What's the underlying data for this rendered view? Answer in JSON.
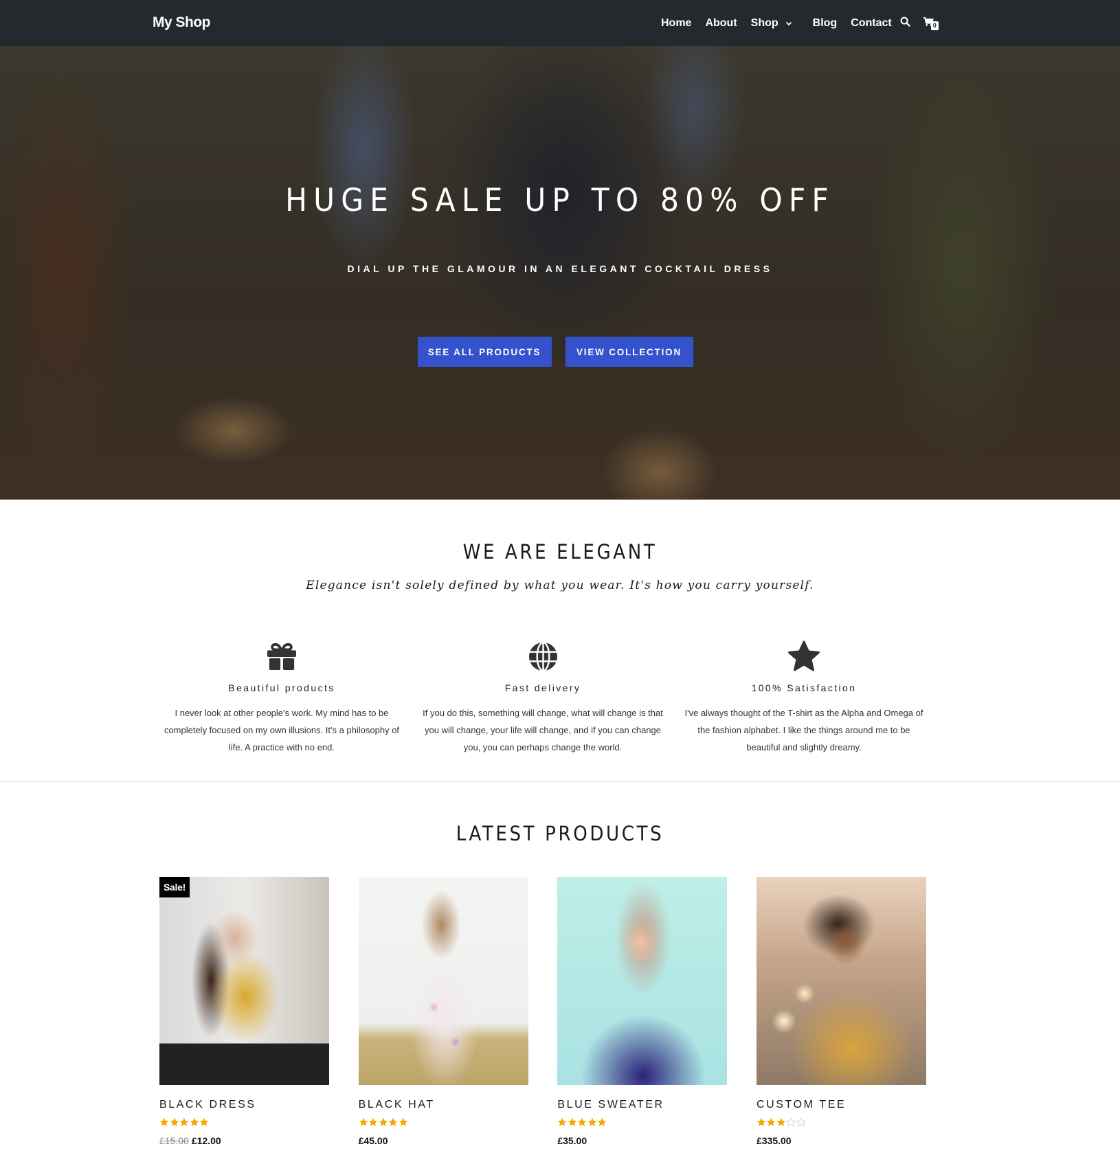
{
  "header": {
    "logo": "My Shop",
    "nav": [
      {
        "label": "Home"
      },
      {
        "label": "About"
      },
      {
        "label": "Shop",
        "has_dropdown": true
      },
      {
        "label": "Blog"
      },
      {
        "label": "Contact"
      }
    ],
    "search_icon": "search-icon",
    "cart_icon": "cart-icon",
    "cart_count": "0"
  },
  "hero": {
    "title": "HUGE SALE UP TO 80% OFF",
    "subtitle": "DIAL UP THE GLAMOUR IN AN ELEGANT COCKTAIL DRESS",
    "buttons": [
      {
        "label": "SEE ALL PRODUCTS"
      },
      {
        "label": "VIEW COLLECTION"
      }
    ]
  },
  "elegant": {
    "title": "WE ARE ELEGANT",
    "subtitle": "Elegance isn't solely defined by what you wear. It's how you carry yourself.",
    "features": [
      {
        "icon": "gift-icon",
        "title": "Beautiful products",
        "text": "I never look at other people's work. My mind has to be completely focused on my own illusions. It's a philosophy of life. A practice with no end."
      },
      {
        "icon": "globe-icon",
        "title": "Fast delivery",
        "text": "If you do this, something will change, what will change is that you will change, your life will change, and if you can change you, you can perhaps change the world."
      },
      {
        "icon": "star-icon",
        "title": "100% Satisfaction",
        "text": "I've always thought of the T-shirt as the Alpha and Omega of the fashion alphabet. I like the things around me to be beautiful and slightly dreamy."
      }
    ]
  },
  "products": {
    "title": "LATEST PRODUCTS",
    "items": [
      {
        "name": "BLACK DRESS",
        "badge": "Sale!",
        "rating": 5,
        "rating_max": 5,
        "old_price": "£15.00",
        "price": "£12.00"
      },
      {
        "name": "BLACK HAT",
        "badge": null,
        "rating": 5,
        "rating_max": 5,
        "old_price": null,
        "price": "£45.00"
      },
      {
        "name": "BLUE SWEATER",
        "badge": null,
        "rating": 5,
        "rating_max": 5,
        "old_price": null,
        "price": "£35.00"
      },
      {
        "name": "CUSTOM TEE",
        "badge": null,
        "rating": 3,
        "rating_max": 5,
        "old_price": null,
        "price": "£335.00"
      }
    ]
  },
  "colors": {
    "navbar_bg": "#25292e",
    "button_bg": "#3352cc",
    "star_filled": "#f5a800",
    "star_empty": "#d8d8d8",
    "sale_badge_bg": "#000000"
  }
}
